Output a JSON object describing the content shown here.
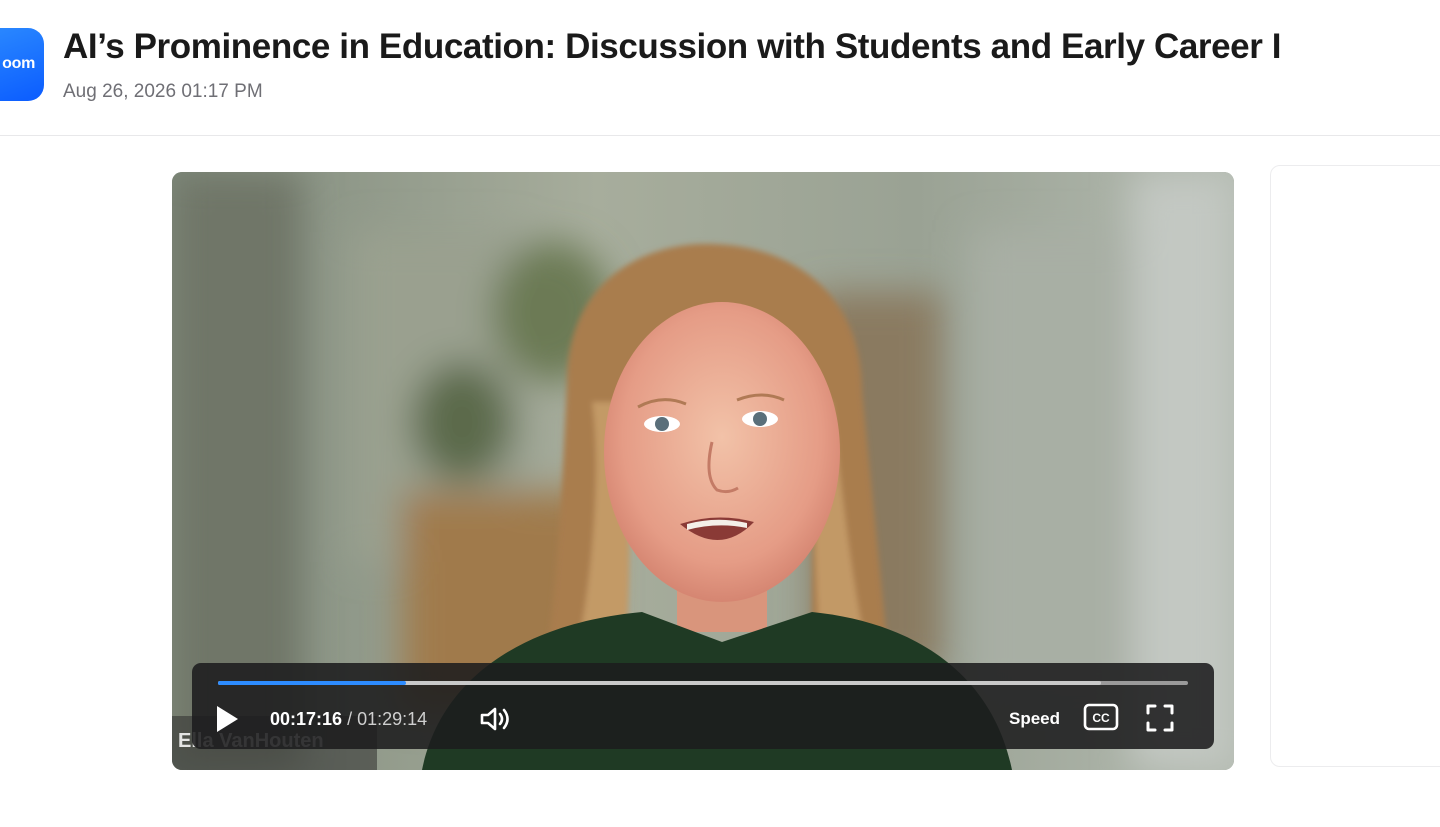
{
  "header": {
    "app_logo_text": "oom",
    "title": "AI’s Prominence in Education: Discussion with Students and Early Career I",
    "date": "Aug 26, 2026 01:17 PM"
  },
  "video": {
    "speaker_name": "Ella VanHouten",
    "current_time": "00:17:16",
    "separator": " / ",
    "duration": "01:29:14",
    "played_fraction": 0.194,
    "buffered_fraction": 0.91,
    "speed_label": "Speed",
    "icons": {
      "play": "play-icon",
      "volume": "volume-icon",
      "captions": "closed-captions-icon",
      "fullscreen": "fullscreen-icon"
    }
  },
  "colors": {
    "accent": "#2d8cff",
    "brand": "#0b5cff",
    "controls_bg": "#1c1c1e"
  }
}
